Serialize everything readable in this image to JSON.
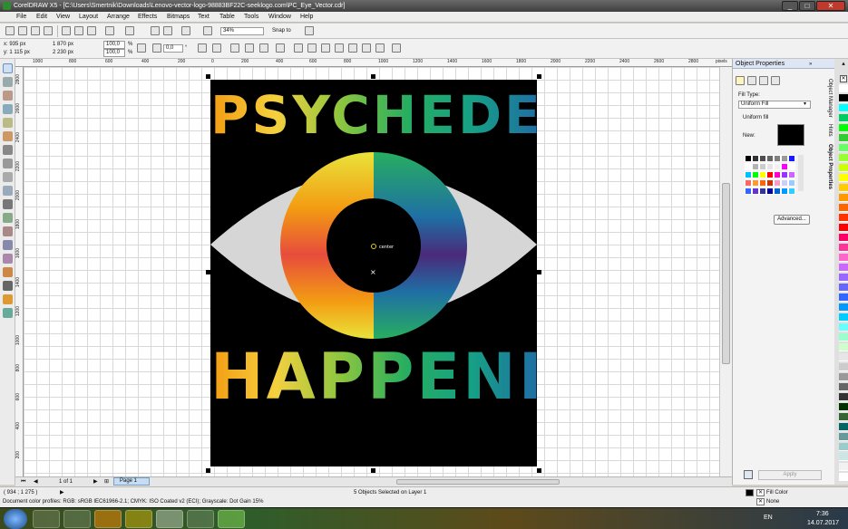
{
  "window": {
    "title": "CorelDRAW X5 - [C:\\Users\\Smertnik\\Downloads\\Lenovo-vector-logo-98883BF22C-seeklogo.com\\PC_Eye_Vector.cdr]"
  },
  "menu": [
    "File",
    "Edit",
    "View",
    "Layout",
    "Arrange",
    "Effects",
    "Bitmaps",
    "Text",
    "Table",
    "Tools",
    "Window",
    "Help"
  ],
  "toolbar": {
    "zoom": "34%",
    "snap_to": "Snap to"
  },
  "property_bar": {
    "x": "x: 935 px",
    "y": "y: 1 115 px",
    "width": "1 870 px",
    "height": "2 230 px",
    "scale_x": "100,0",
    "scale_y": "100,0",
    "pct": "%",
    "angle": "0,0",
    "deg": "°"
  },
  "ruler": {
    "unit": "pixels",
    "top_ticks": [
      "1000",
      "800",
      "600",
      "400",
      "200",
      "0",
      "200",
      "400",
      "600",
      "800",
      "1000",
      "1200",
      "1400",
      "1600",
      "1800",
      "2000",
      "2200",
      "2400",
      "2600",
      "2800"
    ],
    "left_ticks": [
      "2800",
      "2600",
      "2400",
      "2200",
      "2000",
      "1800",
      "1600",
      "1400",
      "1200",
      "1000",
      "800",
      "600",
      "400",
      "200"
    ]
  },
  "artwork": {
    "top_text": "PSYCHEDELIC",
    "bottom_text": "HAPPENING",
    "center_label": "center"
  },
  "page_nav": {
    "position": "1 of 1",
    "page_tab": "Page 1"
  },
  "docker": {
    "title": "Object Properties",
    "fill_type_label": "Fill Type:",
    "fill_type_value": "Uniform Fill",
    "uniform_fill_label": "Uniform fill",
    "new_label": "New:",
    "advanced_button": "Advanced...",
    "apply_button": "Apply",
    "side_tabs": [
      "Object Manager",
      "Hints",
      "Object Properties"
    ],
    "swatches": [
      "#000000",
      "#333333",
      "#4d4d4d",
      "#666666",
      "#808080",
      "#999999",
      "#1a1aff",
      "#ffffff",
      "#b3b3b3",
      "#cccccc",
      "#e6e6e6",
      "#f2f2f2",
      "#ff00ff",
      "#ffffff",
      "#00bfff",
      "#00ff00",
      "#ffff00",
      "#ff0000",
      "#ff00cc",
      "#9933ff",
      "#cc66ff",
      "#ff6666",
      "#ff9933",
      "#ff6600",
      "#cc3300",
      "#ff99cc",
      "#ccccff",
      "#99ccff",
      "#3366ff",
      "#6633cc",
      "#333399",
      "#000099",
      "#0066cc",
      "#0099ff",
      "#33ccff"
    ]
  },
  "palette_colors": [
    "#ffffff",
    "#000000",
    "#00ffff",
    "#00cc66",
    "#00ff00",
    "#33cc33",
    "#66ff66",
    "#99ff33",
    "#ccff00",
    "#ffff00",
    "#ffcc00",
    "#ff9900",
    "#ff6600",
    "#ff3300",
    "#ff0000",
    "#ff0066",
    "#ff3399",
    "#ff66cc",
    "#cc66ff",
    "#9966ff",
    "#6666ff",
    "#3366ff",
    "#0099ff",
    "#00ccff",
    "#66ffff",
    "#99ffcc",
    "#ccffcc",
    "#e6e6e6",
    "#cccccc",
    "#999999",
    "#666666",
    "#333333",
    "#003300",
    "#336633",
    "#006666",
    "#669999",
    "#99cccc",
    "#cce6e6",
    "#f2f2f2",
    "#ffffff"
  ],
  "status": {
    "coords": "( 934 ; 1 275 )",
    "selection": "5 Objects Selected on Layer 1",
    "profiles": "Document color profiles: RGB: sRGB IEC61966-2.1; CMYK: ISO Coated v2 (ECI); Grayscale: Dot Gain 15%",
    "fill": "Fill Color",
    "outline": "None"
  },
  "taskbar": {
    "lang": "EN",
    "time": "7:36",
    "date": "14.07.2017"
  }
}
